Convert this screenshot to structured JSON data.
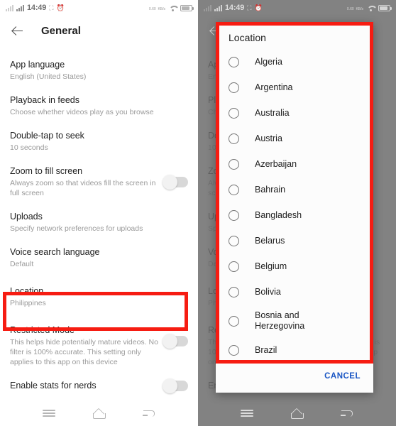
{
  "statusbar": {
    "time": "14:49",
    "left_icons": [
      "signal-weak-icon",
      "signal-strong-icon",
      "no-sim-icon",
      "alarm-icon"
    ],
    "right_icons": [
      "network-speed-icon",
      "wifi-icon",
      "battery-icon"
    ],
    "network_speed_top": "0.60",
    "network_speed_bottom": "KB/s"
  },
  "left_screen": {
    "appbar": {
      "back_label": "back-arrow",
      "title": "General"
    },
    "settings": [
      {
        "title": "App language",
        "subtitle": "English (United States)",
        "toggle": null
      },
      {
        "title": "Playback in feeds",
        "subtitle": "Choose whether videos play as you browse",
        "toggle": null
      },
      {
        "title": "Double-tap to seek",
        "subtitle": "10 seconds",
        "toggle": null
      },
      {
        "title": "Zoom to fill screen",
        "subtitle": "Always zoom so that videos fill the screen in full screen",
        "toggle": "off"
      },
      {
        "title": "Uploads",
        "subtitle": "Specify network preferences for uploads",
        "toggle": null
      },
      {
        "title": "Voice search language",
        "subtitle": "Default",
        "toggle": null
      },
      {
        "title": "Location",
        "subtitle": "Philippines",
        "toggle": null
      },
      {
        "title": "Restricted Mode",
        "subtitle": "This helps hide potentially mature videos. No filter is 100% accurate. This setting only applies to this app on this device",
        "toggle": "off"
      },
      {
        "title": "Enable stats for nerds",
        "subtitle": "",
        "toggle": "off"
      }
    ]
  },
  "right_screen": {
    "dialog": {
      "title": "Location",
      "items": [
        "Algeria",
        "Argentina",
        "Australia",
        "Austria",
        "Azerbaijan",
        "Bahrain",
        "Bangladesh",
        "Belarus",
        "Belgium",
        "Bolivia",
        "Bosnia and Herzegovina",
        "Brazil"
      ],
      "selected": null,
      "cancel_label": "CANCEL"
    }
  },
  "navbar": {
    "items": [
      "recents-icon",
      "home-icon",
      "back-icon"
    ]
  },
  "annotations": {
    "highlight_color": "#f61c12",
    "boxes": [
      "location-row-highlight",
      "location-dialog-highlight"
    ]
  }
}
